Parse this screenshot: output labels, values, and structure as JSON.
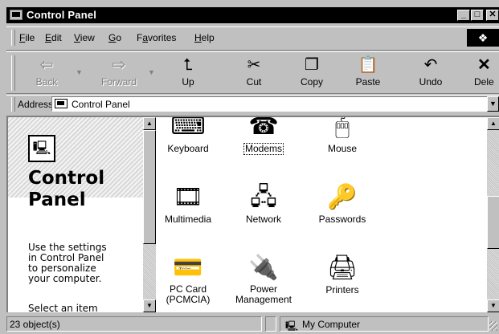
{
  "window": {
    "title": "Control Panel"
  },
  "title_buttons": {
    "minimize": "_",
    "maximize": "□",
    "close": "✕"
  },
  "menu": [
    {
      "label": "File",
      "accel": "F",
      "rest": "ile"
    },
    {
      "label": "Edit",
      "accel": "E",
      "rest": "dit"
    },
    {
      "label": "View",
      "accel": "V",
      "rest": "iew"
    },
    {
      "label": "Go",
      "accel": "G",
      "rest": "o"
    },
    {
      "label": "Favorites",
      "accel": "a",
      "pre": "F",
      "rest": "vorites"
    },
    {
      "label": "Help",
      "accel": "H",
      "rest": "elp"
    }
  ],
  "toolbar": {
    "back": {
      "label": "Back",
      "icon": "back-arrow-icon",
      "glyph": "⇦",
      "enabled": false
    },
    "forward": {
      "label": "Forward",
      "icon": "forward-arrow-icon",
      "glyph": "⇨",
      "enabled": false
    },
    "up": {
      "label": "Up",
      "icon": "up-folder-icon",
      "glyph": "⮤",
      "enabled": true
    },
    "cut": {
      "label": "Cut",
      "icon": "scissors-icon",
      "glyph": "✂",
      "enabled": true
    },
    "copy": {
      "label": "Copy",
      "icon": "copy-icon",
      "glyph": "❐",
      "enabled": true
    },
    "paste": {
      "label": "Paste",
      "icon": "clipboard-icon",
      "glyph": "📋",
      "enabled": true
    },
    "undo": {
      "label": "Undo",
      "icon": "undo-icon",
      "glyph": "↶",
      "enabled": true
    },
    "delete": {
      "label": "Dele",
      "icon": "delete-x-icon",
      "glyph": "✕",
      "enabled": true
    }
  },
  "address": {
    "label": "Address",
    "value": "Control Panel"
  },
  "left_pane": {
    "title_line1": "Control",
    "title_line2": "Panel",
    "desc": [
      "Use the settings",
      "in Control Panel",
      "to personalize",
      "your computer."
    ],
    "select": "Select an item"
  },
  "items": [
    {
      "name": "Keyboard",
      "icon": "keyboard-icon",
      "glyph": "⌨"
    },
    {
      "name": "Modems",
      "icon": "telephone-icon",
      "glyph": "☎",
      "focused": true
    },
    {
      "name": "Mouse",
      "icon": "mouse-icon",
      "glyph": "🖱"
    },
    {
      "name": "Multimedia",
      "icon": "multimedia-icon",
      "glyph": "🎞"
    },
    {
      "name": "Network",
      "icon": "network-icon",
      "glyph": "🖧"
    },
    {
      "name": "Passwords",
      "icon": "keys-icon",
      "glyph": "🔑"
    },
    {
      "name": "PC Card",
      "name2": "(PCMCIA)",
      "icon": "pc-card-icon",
      "glyph": "💳"
    },
    {
      "name": "Power",
      "name2": "Management",
      "icon": "power-plug-icon",
      "glyph": "🔌"
    },
    {
      "name": "Printers",
      "icon": "printer-folder-icon",
      "glyph": "🖨"
    }
  ],
  "status": {
    "count": "23 object(s)",
    "zone": "My Computer",
    "zone_icon": "computer-icon"
  }
}
